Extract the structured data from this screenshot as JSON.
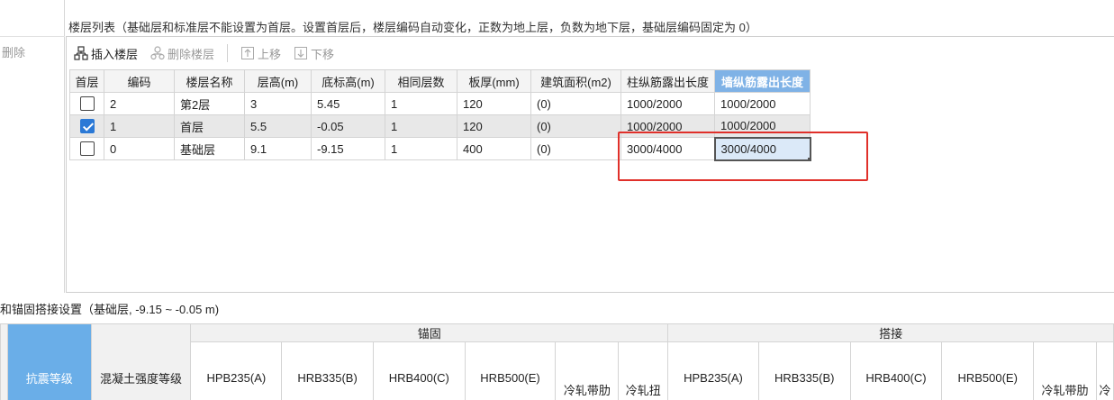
{
  "left_strip": {
    "delete_label": "删除"
  },
  "floor_list": {
    "title": "楼层列表（基础层和标准层不能设置为首层。设置首层后，楼层编码自动变化，正数为地上层，负数为地下层，基础层编码固定为 0）",
    "toolbar": {
      "insert": "插入楼层",
      "delete": "删除楼层",
      "move_up": "上移",
      "move_down": "下移"
    },
    "columns": [
      "首层",
      "编码",
      "楼层名称",
      "层高(m)",
      "底标高(m)",
      "相同层数",
      "板厚(mm)",
      "建筑面积(m2)",
      "柱纵筋露出长度",
      "墙纵筋露出长度"
    ],
    "rows": [
      {
        "first": false,
        "code": "2",
        "name": "第2层",
        "height": "3",
        "bottom": "5.45",
        "same": "1",
        "slab": "120",
        "area": "(0)",
        "col_rebar": "1000/2000",
        "wall_rebar": "1000/2000"
      },
      {
        "first": true,
        "code": "1",
        "name": "首层",
        "height": "5.5",
        "bottom": "-0.05",
        "same": "1",
        "slab": "120",
        "area": "(0)",
        "col_rebar": "1000/2000",
        "wall_rebar": "1000/2000"
      },
      {
        "first": false,
        "code": "0",
        "name": "基础层",
        "height": "9.1",
        "bottom": "-9.15",
        "same": "1",
        "slab": "400",
        "area": "(0)",
        "col_rebar": "3000/4000",
        "wall_rebar": "3000/4000"
      }
    ],
    "selected_column": "墙纵筋露出长度",
    "highlight_color": "#e0302a",
    "accent_color": "#2b79d6"
  },
  "anchor_settings": {
    "title": "和锚固搭接设置（基础层, -9.15 ~ -0.05 m)",
    "seismic_grade": "抗震等级",
    "concrete_grade": "混凝土强度等级",
    "anchorage_group": "锚固",
    "lap_group": "搭接",
    "anchorage_cols": [
      "HPB235(A)",
      "HRB335(B)",
      "HRB400(C)",
      "HRB500(E)",
      "冷轧带肋",
      "冷轧扭"
    ],
    "lap_cols": [
      "HPB235(A)",
      "HRB335(B)",
      "HRB400(C)",
      "HRB500(E)",
      "冷轧带肋",
      "冷"
    ]
  }
}
